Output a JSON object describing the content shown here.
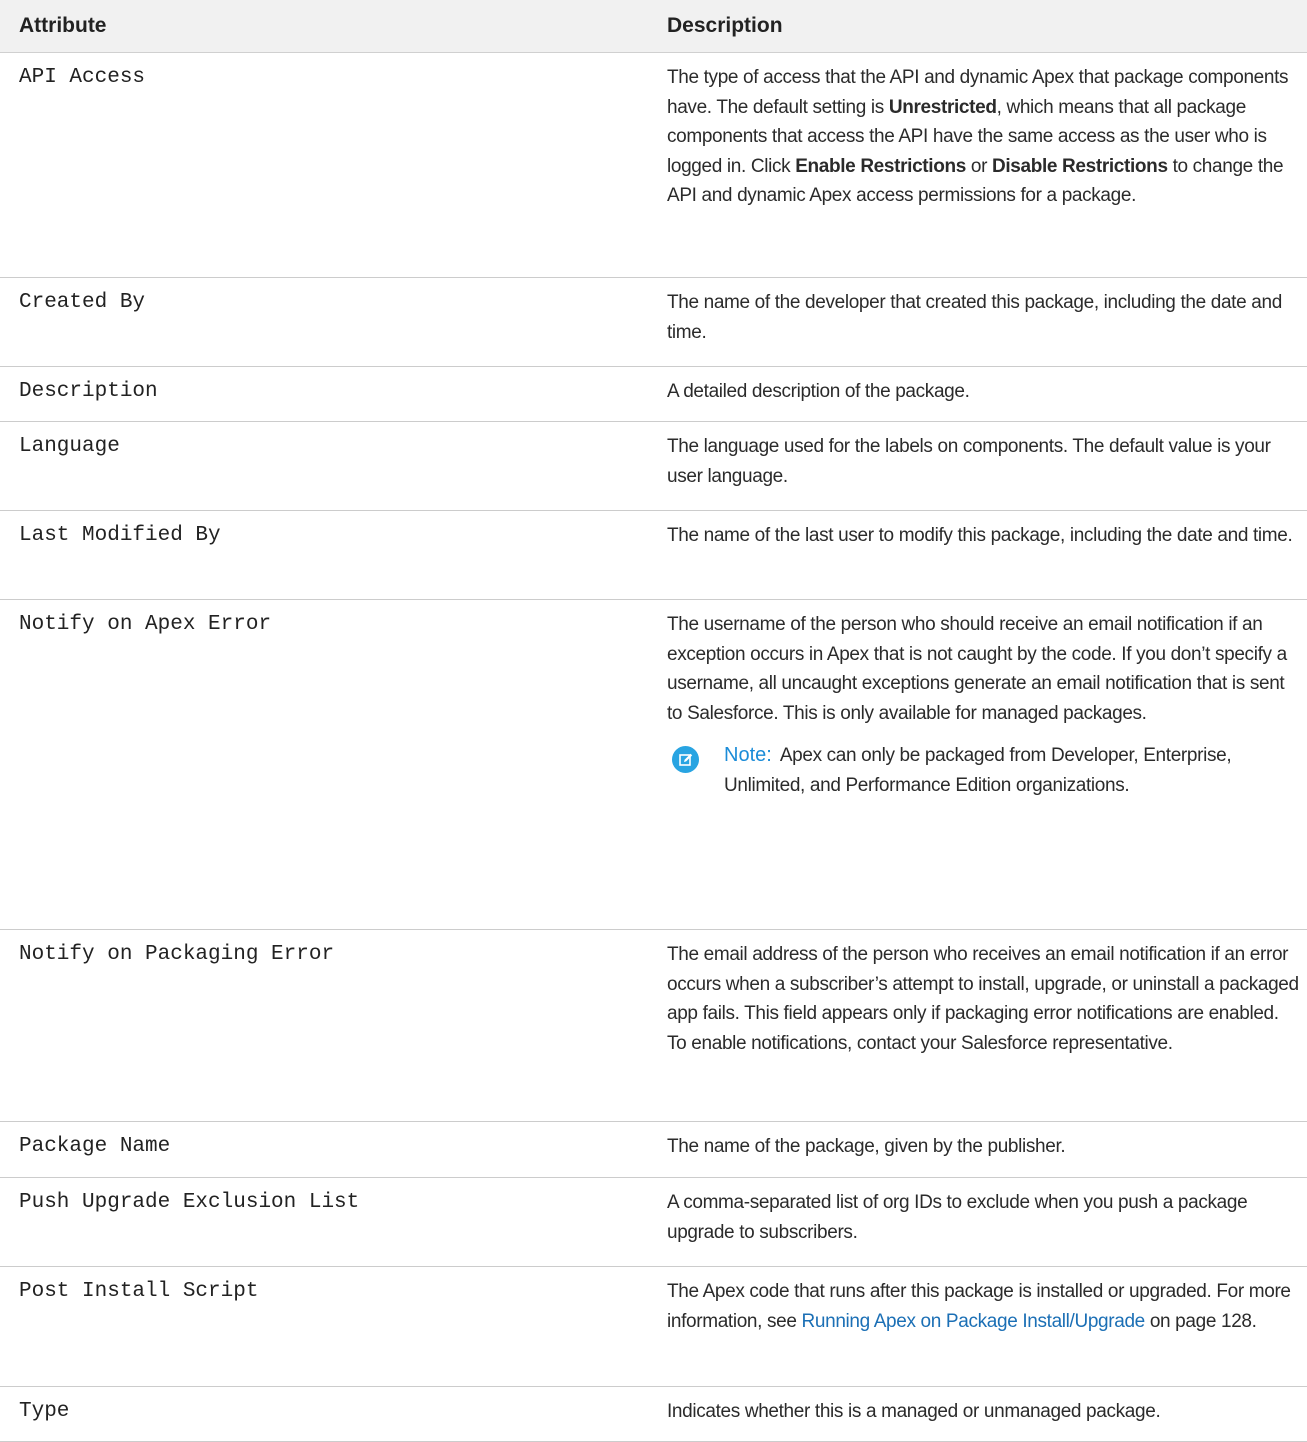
{
  "headers": {
    "attribute": "Attribute",
    "description": "Description"
  },
  "rows": [
    {
      "attr": "API Access",
      "d1": "The type of access that the API and dynamic Apex that package components have. The default setting is ",
      "b1": "Unrestricted",
      "d2": ", which means that all package components that access the API have the same access as the user who is logged in. Click ",
      "b2": "Enable Restrictions",
      "d3": " or ",
      "b3": "Disable Restrictions",
      "d4": " to change the API and dynamic Apex access permissions for a package."
    },
    {
      "attr": "Created By",
      "desc": "The name of the developer that created this package, including the date and time."
    },
    {
      "attr": "Description",
      "desc": "A detailed description of the package."
    },
    {
      "attr": "Language",
      "desc": "The language used for the labels on components. The default value is your user language."
    },
    {
      "attr": "Last Modified By",
      "desc": "The name of the last user to modify this package, including the date and time."
    },
    {
      "attr": "Notify on Apex Error",
      "desc": "The username of the person who should receive an email notification if an exception occurs in Apex that is not caught by the code. If you don’t specify a username, all uncaught exceptions generate an email notification that is sent to Salesforce. This is only available for managed packages.",
      "note_label": "Note:",
      "note_text": "Apex can only be packaged from Developer, Enterprise, Unlimited, and Performance Edition organizations."
    },
    {
      "attr": "Notify on Packaging Error",
      "desc": "The email address of the person who receives an email notification if an error occurs when a subscriber’s attempt to install, upgrade, or uninstall a packaged app fails. This field appears only if packaging error notifications are enabled. To enable notifications, contact your Salesforce representative."
    },
    {
      "attr": "Package Name",
      "desc": "The name of the package, given by the publisher."
    },
    {
      "attr": "Push Upgrade Exclusion List",
      "desc": "A comma-separated list of org IDs to exclude when you push a package upgrade to subscribers."
    },
    {
      "attr": "Post Install Script",
      "d1": "The Apex code that runs after this package is installed or upgraded. For more information, see ",
      "link": "Running Apex on Package Install/Upgrade",
      "d2": " on page 128."
    },
    {
      "attr": "Type",
      "desc": "Indicates whether this is a managed or unmanaged package."
    }
  ],
  "icons": {
    "note": "pencil-edit-icon"
  },
  "colors": {
    "header_bg": "#f1f1f1",
    "link": "#1b6fb5",
    "note_label": "#1b8cd8",
    "note_icon": "#28a4e2",
    "row_border": "#cccccc"
  }
}
